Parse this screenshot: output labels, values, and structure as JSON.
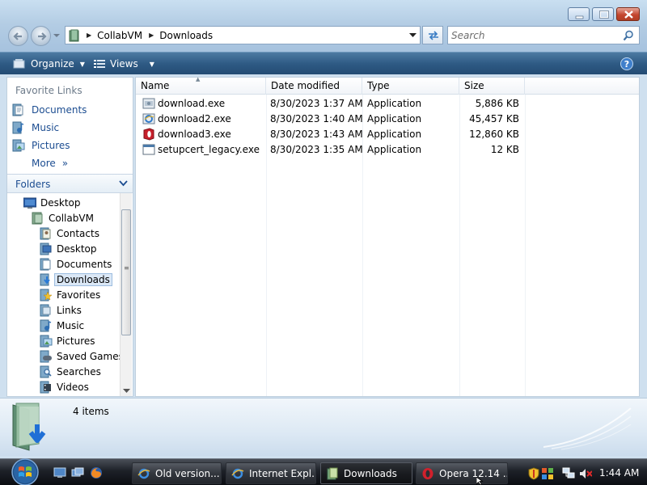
{
  "address": {
    "crumbs": [
      "CollabVM",
      "Downloads"
    ]
  },
  "search": {
    "placeholder": "Search"
  },
  "commandbar": {
    "organize_label": "Organize",
    "views_label": "Views"
  },
  "navpane": {
    "favorites_title": "Favorite Links",
    "favorites": [
      {
        "label": "Documents",
        "icon": "documents-icon"
      },
      {
        "label": "Music",
        "icon": "music-icon"
      },
      {
        "label": "Pictures",
        "icon": "pictures-icon"
      }
    ],
    "more_label": "More",
    "folders_title": "Folders",
    "tree": [
      {
        "label": "Desktop",
        "icon": "desktop-icon",
        "level": 0
      },
      {
        "label": "CollabVM",
        "icon": "user-folder-icon",
        "level": 1
      },
      {
        "label": "Contacts",
        "icon": "contacts-icon",
        "level": 2
      },
      {
        "label": "Desktop",
        "icon": "desktop-folder-icon",
        "level": 2
      },
      {
        "label": "Documents",
        "icon": "documents-icon",
        "level": 2
      },
      {
        "label": "Downloads",
        "icon": "downloads-icon",
        "level": 2,
        "selected": true
      },
      {
        "label": "Favorites",
        "icon": "favorites-icon",
        "level": 2
      },
      {
        "label": "Links",
        "icon": "links-icon",
        "level": 2
      },
      {
        "label": "Music",
        "icon": "music-icon",
        "level": 2
      },
      {
        "label": "Pictures",
        "icon": "pictures-icon",
        "level": 2
      },
      {
        "label": "Saved Games",
        "icon": "saved-games-icon",
        "level": 2
      },
      {
        "label": "Searches",
        "icon": "searches-icon",
        "level": 2
      },
      {
        "label": "Videos",
        "icon": "videos-icon",
        "level": 2
      }
    ]
  },
  "filelist": {
    "columns": [
      "Name",
      "Date modified",
      "Type",
      "Size"
    ],
    "rows": [
      {
        "name": "download.exe",
        "date": "8/30/2023 1:37 AM",
        "type": "Application",
        "size": "5,886 KB",
        "icon": "installer-icon"
      },
      {
        "name": "download2.exe",
        "date": "8/30/2023 1:40 AM",
        "type": "Application",
        "size": "45,457 KB",
        "icon": "ie-installer-icon"
      },
      {
        "name": "download3.exe",
        "date": "8/30/2023 1:43 AM",
        "type": "Application",
        "size": "12,860 KB",
        "icon": "opera-installer-icon"
      },
      {
        "name": "setupcert_legacy.exe",
        "date": "8/30/2023 1:35 AM",
        "type": "Application",
        "size": "12 KB",
        "icon": "application-icon"
      }
    ]
  },
  "details": {
    "item_count": "4 items"
  },
  "taskbar": {
    "tasks": [
      {
        "label": "Old version...",
        "icon": "ie-icon",
        "active": false
      },
      {
        "label": "Internet Expl...",
        "icon": "ie-icon",
        "active": false
      },
      {
        "label": "Downloads",
        "icon": "folder-icon",
        "active": true
      },
      {
        "label": "Opera 12.14 ...",
        "icon": "opera-icon",
        "active": false
      }
    ],
    "clock": "1:44 AM"
  },
  "colors": {
    "command_bar": "#2f5b85",
    "link_blue": "#1c4d91",
    "taskbar": "#1d2128",
    "close_red": "#c4462f"
  }
}
